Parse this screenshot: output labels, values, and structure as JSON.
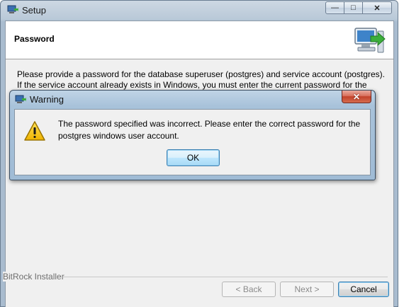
{
  "window": {
    "title": "Setup",
    "minimize_glyph": "—",
    "maximize_glyph": "□",
    "close_glyph": "✕"
  },
  "header": {
    "title": "Password",
    "icon": "computer-install-icon"
  },
  "description": "Please provide a password for the database superuser (postgres) and service account (postgres). If the service account already exists in Windows, you must enter the current password for the account. If the",
  "footer": {
    "installer_label": "BitRock Installer",
    "back_label": "< Back",
    "next_label": "Next >",
    "cancel_label": "Cancel"
  },
  "dialog": {
    "title": "Warning",
    "close_glyph": "✕",
    "icon": "warning-icon",
    "message": "The password specified was incorrect. Please enter the correct password for the postgres windows user account.",
    "ok_label": "OK"
  },
  "colors": {
    "title_bar": "#b9c9d8",
    "client_bg": "#f0f0f0",
    "dialog_close": "#c2412a",
    "warning_yellow": "#f5c400",
    "button_focus_border": "#3c7fb1"
  }
}
